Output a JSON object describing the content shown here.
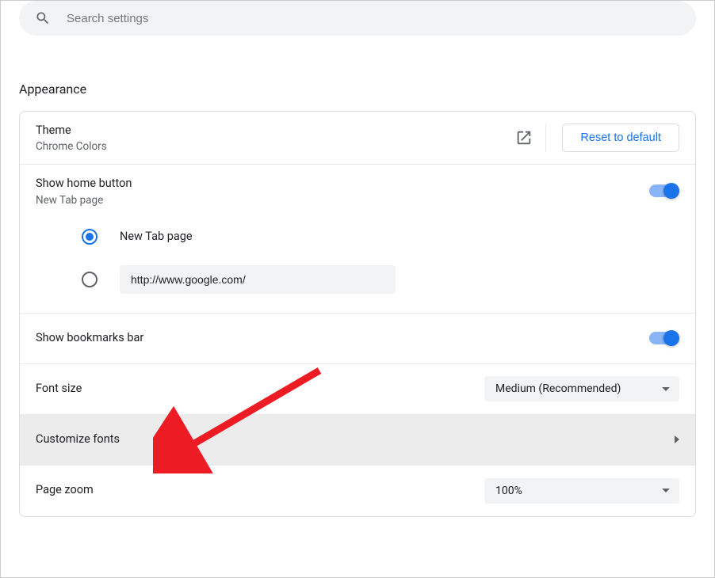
{
  "search": {
    "placeholder": "Search settings"
  },
  "section_title": "Appearance",
  "theme": {
    "label": "Theme",
    "sub": "Chrome Colors",
    "reset": "Reset to default"
  },
  "home_button": {
    "label": "Show home button",
    "sub": "New Tab page",
    "options": {
      "newtab": "New Tab page",
      "url_value": "http://www.google.com/"
    }
  },
  "bookmarks": {
    "label": "Show bookmarks bar"
  },
  "font_size": {
    "label": "Font size",
    "value": "Medium (Recommended)"
  },
  "customize_fonts": {
    "label": "Customize fonts"
  },
  "page_zoom": {
    "label": "Page zoom",
    "value": "100%"
  }
}
